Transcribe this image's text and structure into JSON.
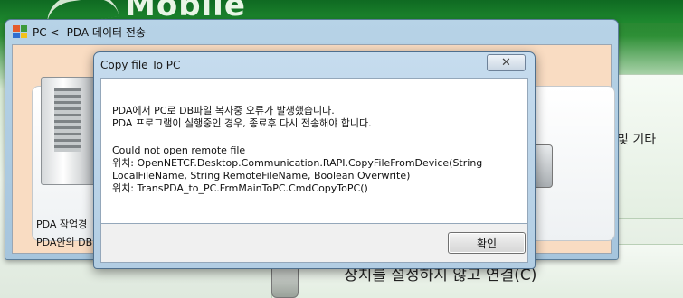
{
  "background": {
    "logo_text": "Mobile",
    "right_panel_text": "및 기타",
    "bottom_panel_text": "장치를 설정하지 않고 연결(C)"
  },
  "parent_window": {
    "title": "PC <- PDA  데이터 전송",
    "status_lines": [
      "PDA 작업경",
      "PDA안의 DB"
    ]
  },
  "dialog": {
    "title": "Copy file To PC",
    "close_label": "✕",
    "message_lines": [
      "PDA에서 PC로 DB파일 복사중 오류가 발생했습니다.",
      "PDA 프로그램이 실행중인 경우, 종료후 다시 전송해야 합니다.",
      "",
      "Could not open remote file",
      "   위치: OpenNETCF.Desktop.Communication.RAPI.CopyFileFromDevice(String",
      "LocalFileName, String RemoteFileName, Boolean Overwrite)",
      "   위치: TransPDA_to_PC.FrmMainToPC.CmdCopyToPC()"
    ],
    "ok_label": "확인"
  }
}
